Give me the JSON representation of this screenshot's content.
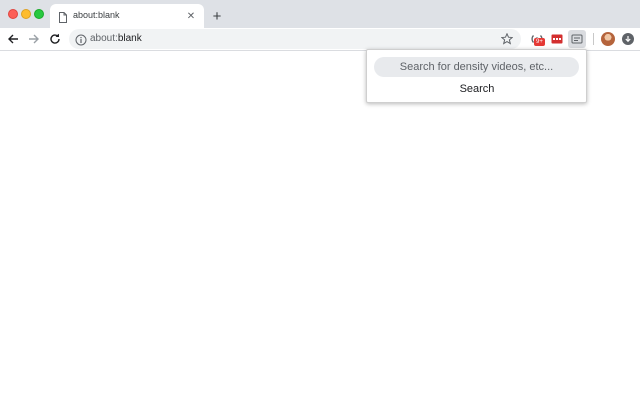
{
  "window": {
    "traffic_lights": {
      "close": "#fc5f57",
      "minimize": "#fdbc2e",
      "zoom": "#28c840"
    }
  },
  "tab": {
    "title": "about:blank",
    "icon": "page-icon",
    "close_glyph": "✕"
  },
  "new_tab_glyph": "+",
  "address_bar": {
    "url_scheme": "about:",
    "url_rest": "blank",
    "icon": "info-icon"
  },
  "extensions": {
    "badge_text": "9+"
  },
  "popup": {
    "search_placeholder": "Search for density videos, etc...",
    "search_value": "",
    "search_button_label": "Search"
  },
  "colors": {
    "tabstrip": "#dee1e6",
    "omnibox": "#f1f3f4",
    "popup_input": "#e8eaed",
    "badge": "#e53935"
  }
}
